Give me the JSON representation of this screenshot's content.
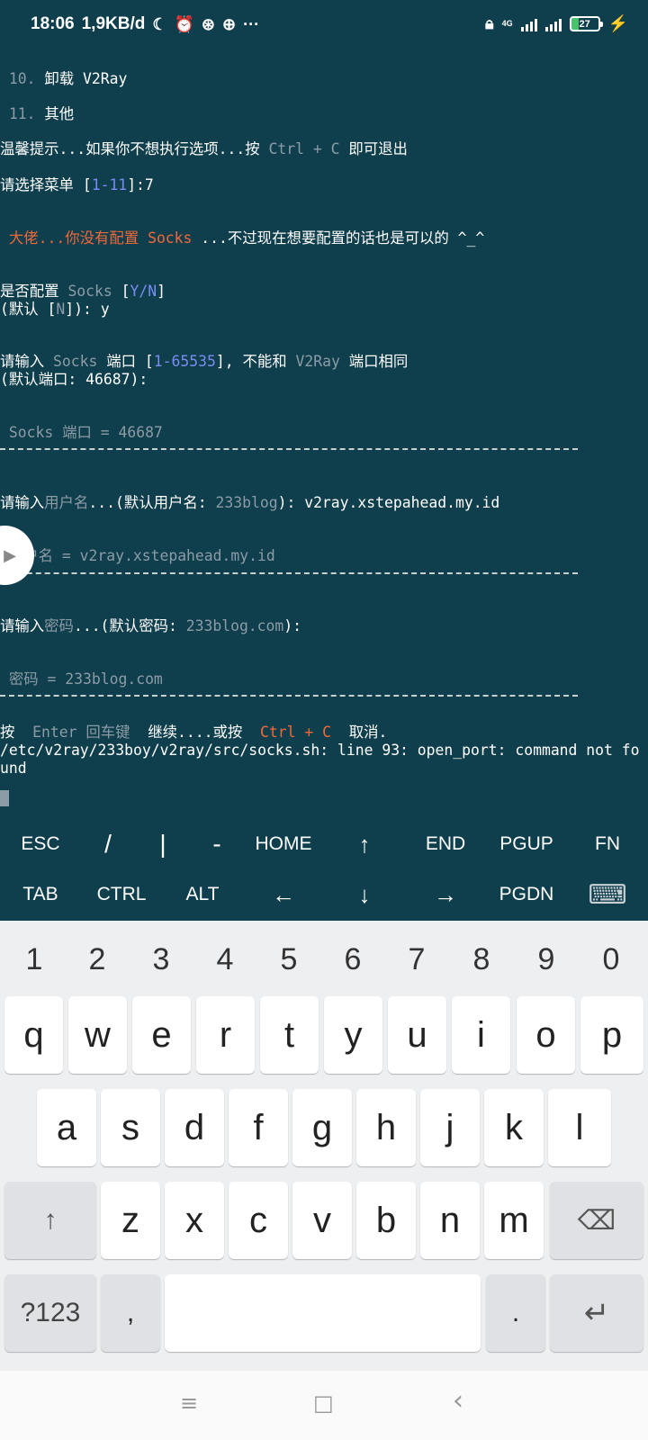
{
  "status_bar": {
    "time": "18:06",
    "net_speed": "1,9KB/d",
    "left_icons": [
      "moon-icon",
      "alarm-icon",
      "app-icon",
      "assistant-icon",
      "more-icon"
    ],
    "network_type": "4G",
    "battery": "27"
  },
  "terminal": {
    "menu_10_num": "10.",
    "menu_10_label": "卸载 V2Ray",
    "menu_11_num": "11.",
    "menu_11_label": "其他",
    "tip_prefix": "温馨提示...如果你不想执行选项...按 ",
    "tip_key": "Ctrl + C",
    "tip_suffix": " 即可退出",
    "select_prefix": "请选择菜单 [",
    "select_range": "1-11",
    "select_suffix": "]:7",
    "notice_orange": " 大佬...你没有配置 Socks",
    "notice_white": " ...不过现在想要配置的话也是可以的 ^_^",
    "ask_socks_prefix": "是否配置 ",
    "ask_socks_word": "Socks",
    "ask_socks_open": " [",
    "ask_socks_yn": "Y/N",
    "ask_socks_close": "]",
    "default_n_prefix": "(默认 [",
    "default_n_value": "N",
    "default_n_suffix": "]): y",
    "port_prompt_1": "请输入 ",
    "port_prompt_socks": "Socks",
    "port_prompt_2": " 端口 [",
    "port_prompt_range": "1-65535",
    "port_prompt_3": "], 不能和 ",
    "port_prompt_v2ray": "V2Ray",
    "port_prompt_4": " 端口相同",
    "port_default": "(默认端口: 46687):",
    "port_result": " Socks 端口 = 46687",
    "user_prompt_1": "请输入",
    "user_prompt_word": "用户名",
    "user_prompt_2": "...(默认用户名: ",
    "user_default": "233blog",
    "user_prompt_3": "): v2ray.xstepahead.my.id",
    "user_result": " 用户名 = v2ray.xstepahead.my.id",
    "pass_prompt_1": "请输入",
    "pass_prompt_word": "密码",
    "pass_prompt_2": "...(默认密码: ",
    "pass_default": "233blog.com",
    "pass_prompt_3": "):",
    "pass_result": " 密码 = 233blog.com",
    "continue_1": "按 ",
    "continue_enter": " Enter 回车键 ",
    "continue_2": " 继续....或按 ",
    "continue_ctrl": " Ctrl + C ",
    "continue_3": " 取消.",
    "error_line1": "/etc/v2ray/233boy/v2ray/src/socks.sh: line 93: open_port: command not fo",
    "error_line2": "und"
  },
  "extra_keys": {
    "row1": [
      "ESC",
      "/",
      "|",
      "-",
      "HOME",
      "↑",
      "END",
      "PGUP",
      "FN"
    ],
    "row2": [
      "TAB",
      "CTRL",
      "ALT",
      "←",
      "↓",
      "→",
      "PGDN",
      "⌨"
    ]
  },
  "keyboard": {
    "numbers": [
      "1",
      "2",
      "3",
      "4",
      "5",
      "6",
      "7",
      "8",
      "9",
      "0"
    ],
    "row1": [
      "q",
      "w",
      "e",
      "r",
      "t",
      "y",
      "u",
      "i",
      "o",
      "p"
    ],
    "row2": [
      "a",
      "s",
      "d",
      "f",
      "g",
      "h",
      "j",
      "k",
      "l"
    ],
    "row3": [
      "z",
      "x",
      "c",
      "v",
      "b",
      "n",
      "m"
    ],
    "shift": "↑",
    "backspace": "⌫",
    "symbols": "?123",
    "comma": ",",
    "period": ".",
    "enter": "↵"
  },
  "nav_bar": {
    "menu": "≡",
    "home": "□",
    "back": "‹"
  }
}
